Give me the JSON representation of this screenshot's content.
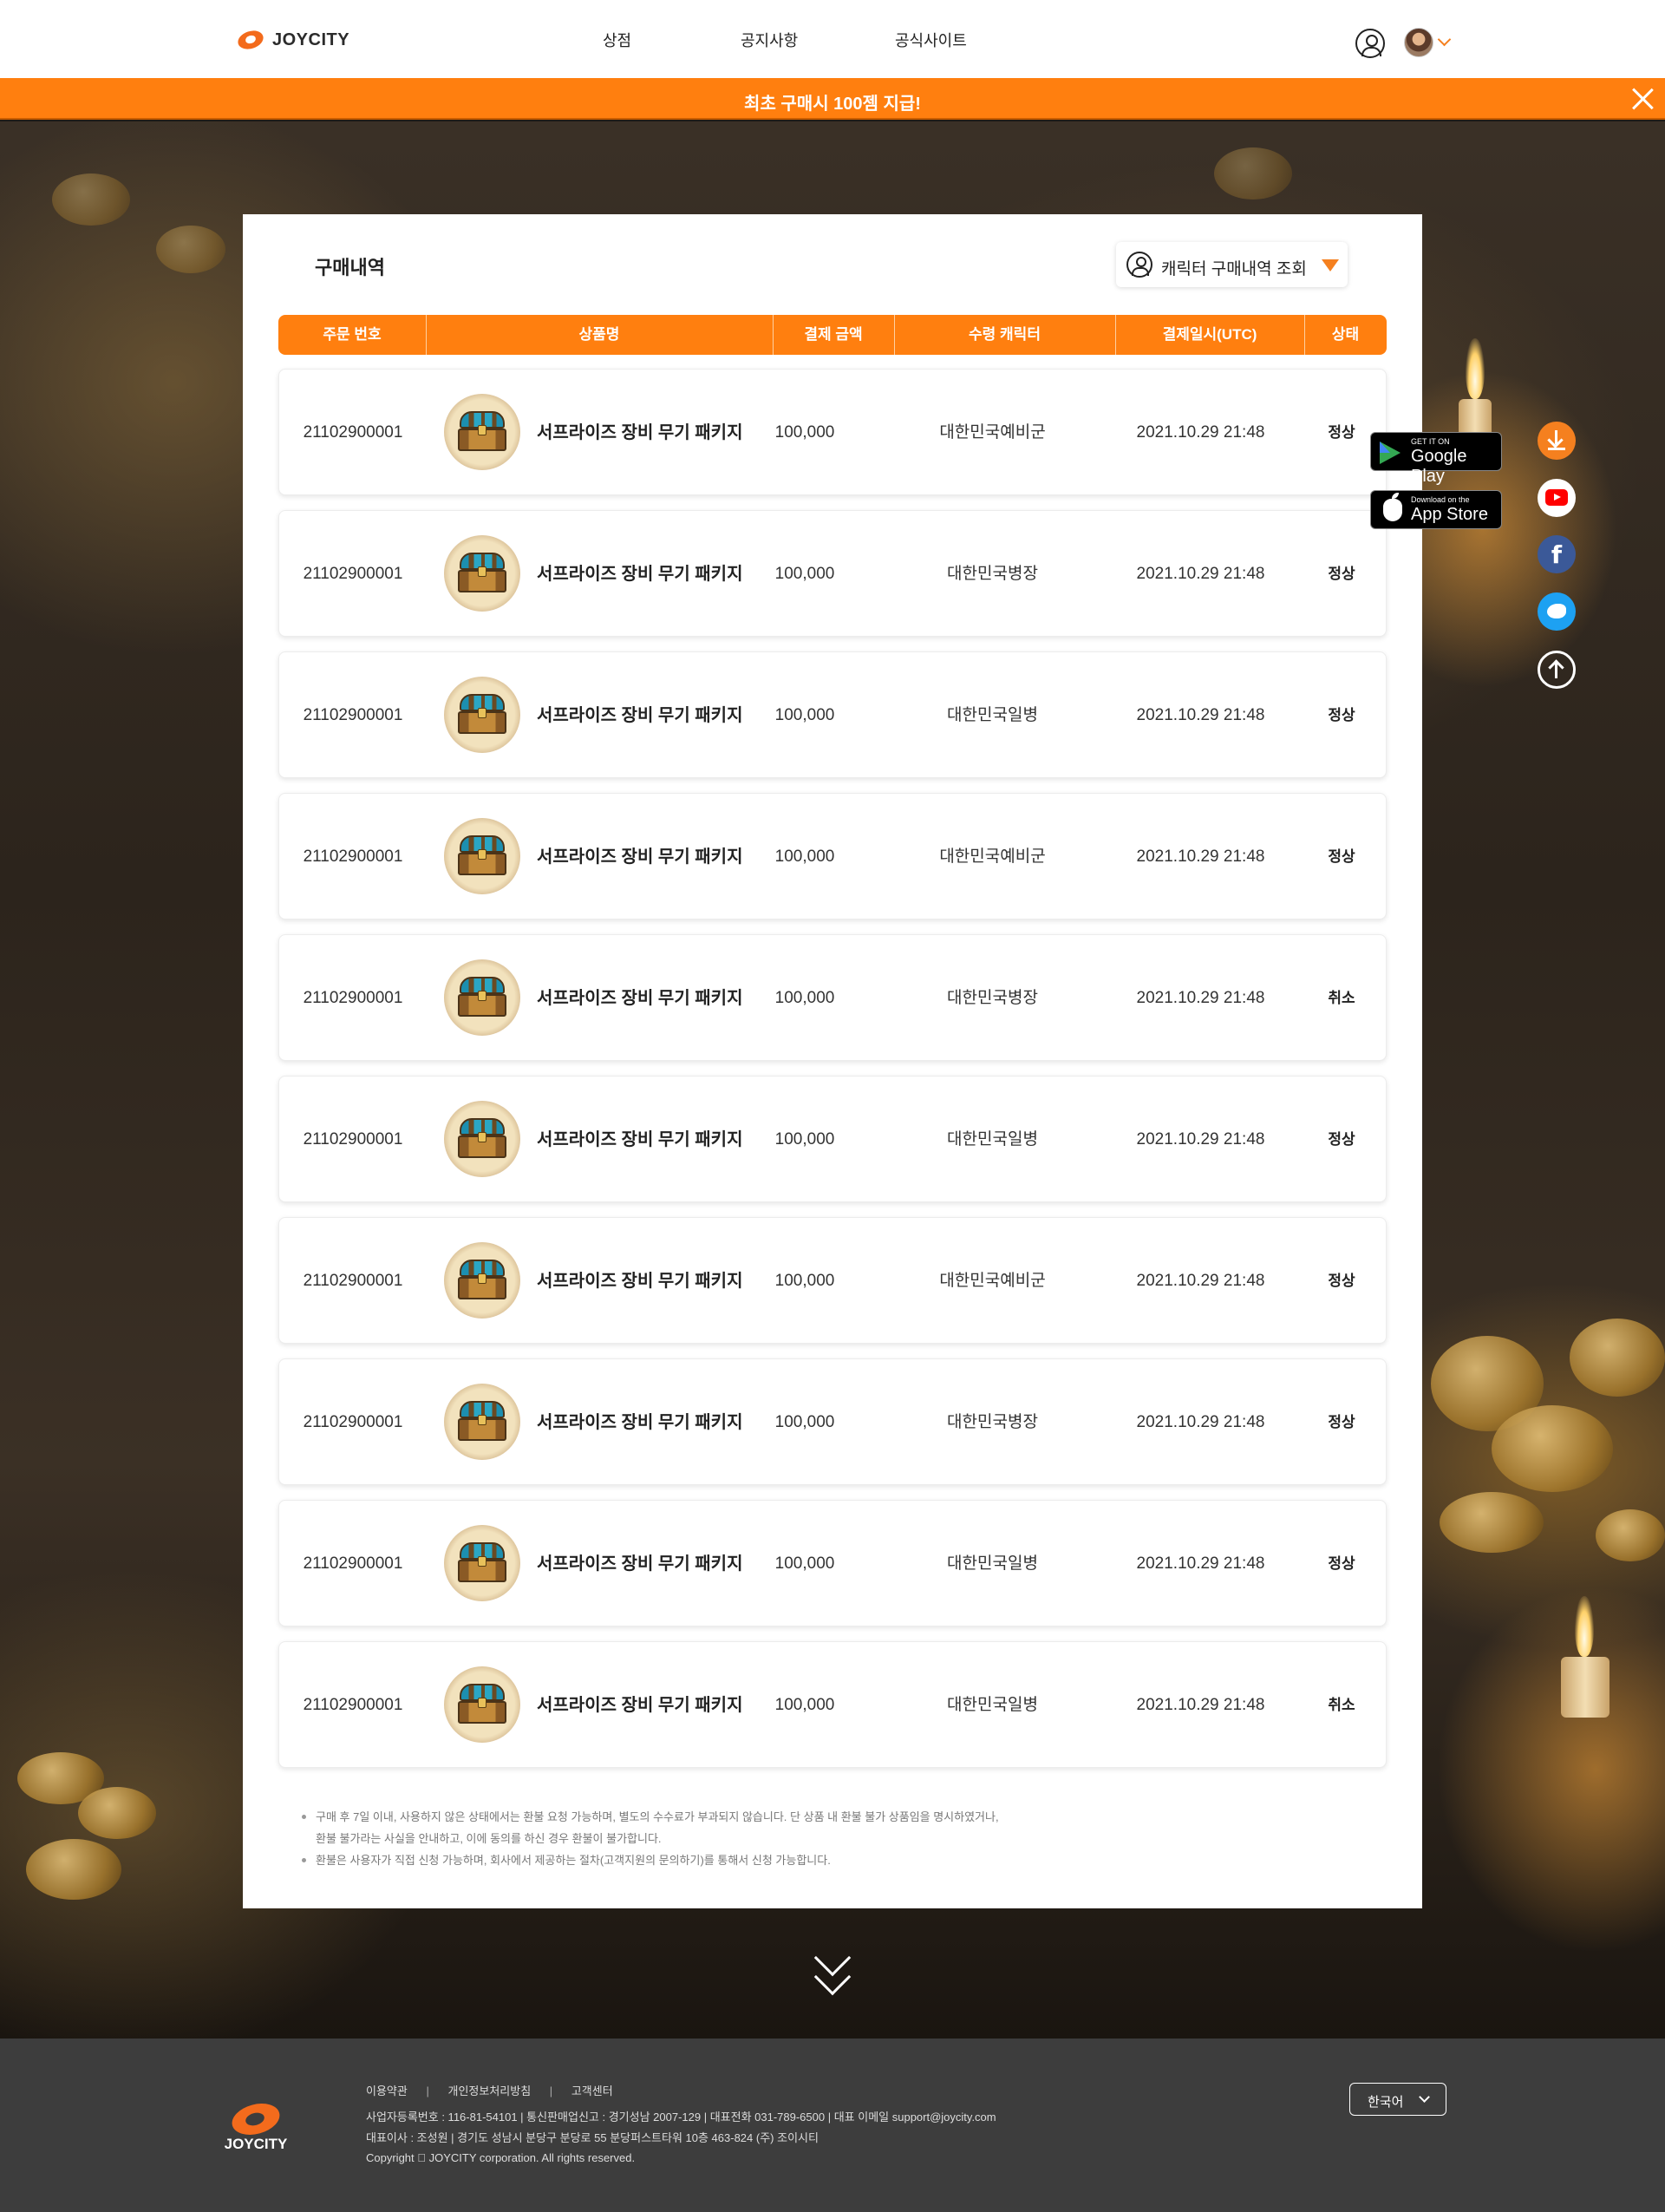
{
  "header": {
    "logo_text": "JOYCITY",
    "nav": [
      "상점",
      "공지사항",
      "공식사이트"
    ]
  },
  "banner": {
    "text": "최초 구매시 100젬 지급!"
  },
  "purchase": {
    "title": "구매내역",
    "character_button": "캐릭터 구매내역 조회",
    "columns": [
      "주문 번호",
      "상품명",
      "결제 금액",
      "수령 캐릭터",
      "결제일시(UTC)",
      "상태"
    ],
    "rows": [
      {
        "order": "21102900001",
        "product": "서프라이즈 장비 무기 패키지",
        "amount": "100,000",
        "character": "대한민국예비군",
        "date": "2021.10.29 21:48",
        "status": "정상"
      },
      {
        "order": "21102900001",
        "product": "서프라이즈 장비 무기 패키지",
        "amount": "100,000",
        "character": "대한민국병장",
        "date": "2021.10.29 21:48",
        "status": "정상"
      },
      {
        "order": "21102900001",
        "product": "서프라이즈 장비 무기 패키지",
        "amount": "100,000",
        "character": "대한민국일병",
        "date": "2021.10.29 21:48",
        "status": "정상"
      },
      {
        "order": "21102900001",
        "product": "서프라이즈 장비 무기 패키지",
        "amount": "100,000",
        "character": "대한민국예비군",
        "date": "2021.10.29 21:48",
        "status": "정상"
      },
      {
        "order": "21102900001",
        "product": "서프라이즈 장비 무기 패키지",
        "amount": "100,000",
        "character": "대한민국병장",
        "date": "2021.10.29 21:48",
        "status": "취소"
      },
      {
        "order": "21102900001",
        "product": "서프라이즈 장비 무기 패키지",
        "amount": "100,000",
        "character": "대한민국일병",
        "date": "2021.10.29 21:48",
        "status": "정상"
      },
      {
        "order": "21102900001",
        "product": "서프라이즈 장비 무기 패키지",
        "amount": "100,000",
        "character": "대한민국예비군",
        "date": "2021.10.29 21:48",
        "status": "정상"
      },
      {
        "order": "21102900001",
        "product": "서프라이즈 장비 무기 패키지",
        "amount": "100,000",
        "character": "대한민국병장",
        "date": "2021.10.29 21:48",
        "status": "정상"
      },
      {
        "order": "21102900001",
        "product": "서프라이즈 장비 무기 패키지",
        "amount": "100,000",
        "character": "대한민국일병",
        "date": "2021.10.29 21:48",
        "status": "정상"
      },
      {
        "order": "21102900001",
        "product": "서프라이즈 장비 무기 패키지",
        "amount": "100,000",
        "character": "대한민국일병",
        "date": "2021.10.29 21:48",
        "status": "취소"
      }
    ],
    "notes": [
      "구매 후 7일 이내, 사용하지 않은 상태에서는 환불 요청 가능하며, 별도의 수수료가 부과되지 않습니다. 단 상품 내 환불 불가 상품임을 명시하였거나,",
      "환불 불가라는 사실을 안내하고, 이에 동의를 하신 경우 환불이 불가합니다.",
      "환불은 사용자가 직접 신청 가능하며, 회사에서 제공하는 절차(고객지원의 문의하기)를 통해서 신청 가능합니다."
    ]
  },
  "side": {
    "google_play_small": "GET IT ON",
    "google_play_big": "Google Play",
    "app_store_small": "Download on the",
    "app_store_big": "App Store",
    "facebook_glyph": "f"
  },
  "footer": {
    "logo_text": "JOYCITY",
    "links": [
      "이용약관",
      "개인정보처리방침",
      "고객센터"
    ],
    "link_sep": "|",
    "info_line1": "사업자등록번호 : 116-81-54101  |  통신판매업신고 : 경기성남 2007-129  |  대표전화 031-789-6500  |  대표 이메일 support@joycity.com",
    "info_line2": "대표이사 : 조성원  |  경기도 성남시 분당구 분당로 55 분당퍼스트타워 10층 463-824 (주) 조이시티",
    "copyright": "Copyright ⃝ JOYCITY corporation. All rights reserved.",
    "language": "한국어"
  }
}
